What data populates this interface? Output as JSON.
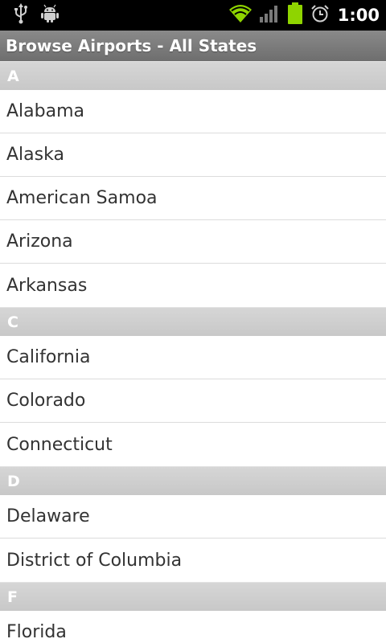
{
  "status_bar": {
    "time": "1:00",
    "icons": [
      "usb-icon",
      "android-debug-icon",
      "wifi-icon",
      "signal-icon",
      "battery-icon",
      "alarm-icon"
    ],
    "wifi_color": "#8fd400",
    "battery_color": "#8fd400"
  },
  "title": "Browse Airports - All States",
  "sections": [
    {
      "letter": "A",
      "items": [
        "Alabama",
        "Alaska",
        "American Samoa",
        "Arizona",
        "Arkansas"
      ]
    },
    {
      "letter": "C",
      "items": [
        "California",
        "Colorado",
        "Connecticut"
      ]
    },
    {
      "letter": "D",
      "items": [
        "Delaware",
        "District of Columbia"
      ]
    },
    {
      "letter": "F",
      "items": [
        "Florida"
      ]
    }
  ]
}
